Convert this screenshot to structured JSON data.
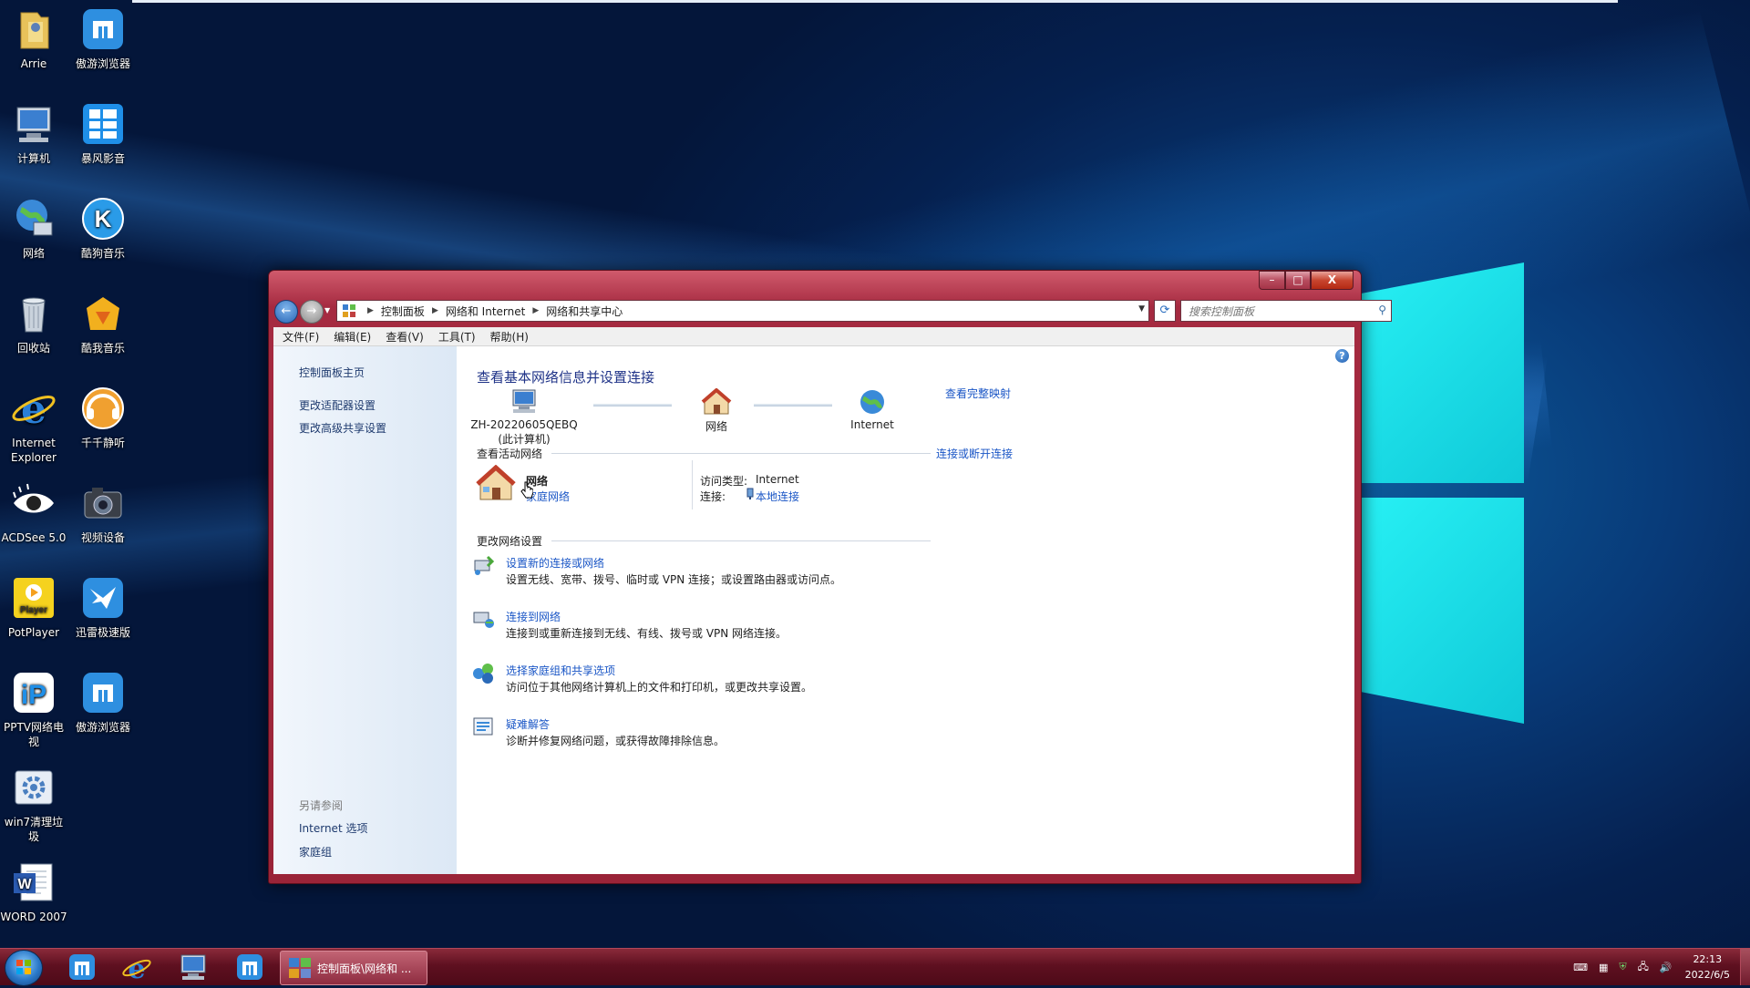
{
  "desktop": {
    "icons": [
      {
        "label": "Arrie",
        "icon": "folder-user-icon"
      },
      {
        "label": "傲游浏览器",
        "icon": "maxthon-browser-icon"
      },
      {
        "label": "计算机",
        "icon": "computer-icon"
      },
      {
        "label": "暴风影音",
        "icon": "baofeng-player-icon"
      },
      {
        "label": "网络",
        "icon": "network-globe-icon"
      },
      {
        "label": "酷狗音乐",
        "icon": "kugou-music-icon"
      },
      {
        "label": "回收站",
        "icon": "recycle-bin-icon"
      },
      {
        "label": "酷我音乐",
        "icon": "kuwo-music-icon"
      },
      {
        "label": "Internet Explorer",
        "icon": "internet-explorer-icon"
      },
      {
        "label": "千千静听",
        "icon": "ttplayer-icon"
      },
      {
        "label": "ACDSee 5.0",
        "icon": "acdsee-eye-icon"
      },
      {
        "label": "视频设备",
        "icon": "camera-icon"
      },
      {
        "label": "PotPlayer",
        "icon": "potplayer-icon"
      },
      {
        "label": "迅雷极速版",
        "icon": "xunlei-bird-icon"
      },
      {
        "label": "PPTV网络电视",
        "icon": "pptv-icon"
      },
      {
        "label": "傲游浏览器",
        "icon": "maxthon-browser-icon"
      },
      {
        "label": "win7清理垃圾",
        "icon": "cleanup-gear-icon"
      },
      {
        "label": "WORD 2007",
        "icon": "word-document-icon"
      }
    ]
  },
  "window": {
    "controls": {
      "minimize": "–",
      "maximize": "□",
      "close": "X"
    },
    "nav": {
      "back": "←",
      "forward": "→"
    },
    "address": {
      "crumbs": [
        "控制面板",
        "网络和 Internet",
        "网络和共享中心"
      ]
    },
    "search": {
      "placeholder": "搜索控制面板"
    },
    "menu": [
      "文件(F)",
      "编辑(E)",
      "查看(V)",
      "工具(T)",
      "帮助(H)"
    ],
    "sidebar": {
      "links": [
        "控制面板主页",
        "更改适配器设置",
        "更改高级共享设置"
      ],
      "see_also_heading": "另请参阅",
      "see_also": [
        "Internet 选项",
        "家庭组"
      ]
    },
    "main": {
      "help": "?",
      "title": "查看基本网络信息并设置连接",
      "map": {
        "computer_name": "ZH-20220605QEBQ",
        "computer_sub": "(此计算机)",
        "network": "网络",
        "internet": "Internet",
        "full_map_link": "查看完整映射"
      },
      "active": {
        "heading": "查看活动网络",
        "connect_link": "连接或断开连接",
        "network_name": "网络",
        "network_type": "家庭网络",
        "access_label": "访问类型:",
        "access_value": "Internet",
        "conn_label": "连接:",
        "conn_value": "本地连接"
      },
      "change": {
        "heading": "更改网络设置",
        "options": [
          {
            "title": "设置新的连接或网络",
            "desc": "设置无线、宽带、拨号、临时或 VPN 连接；或设置路由器或访问点。",
            "icon": "new-connection-icon"
          },
          {
            "title": "连接到网络",
            "desc": "连接到或重新连接到无线、有线、拨号或 VPN 网络连接。",
            "icon": "connect-network-icon"
          },
          {
            "title": "选择家庭组和共享选项",
            "desc": "访问位于其他网络计算机上的文件和打印机，或更改共享设置。",
            "icon": "homegroup-icon"
          },
          {
            "title": "疑难解答",
            "desc": "诊断并修复网络问题，或获得故障排除信息。",
            "icon": "troubleshoot-icon"
          }
        ]
      }
    }
  },
  "taskbar": {
    "active_task": "控制面板\\网络和 ...",
    "clock_time": "22:13",
    "clock_date": "2022/6/5"
  }
}
